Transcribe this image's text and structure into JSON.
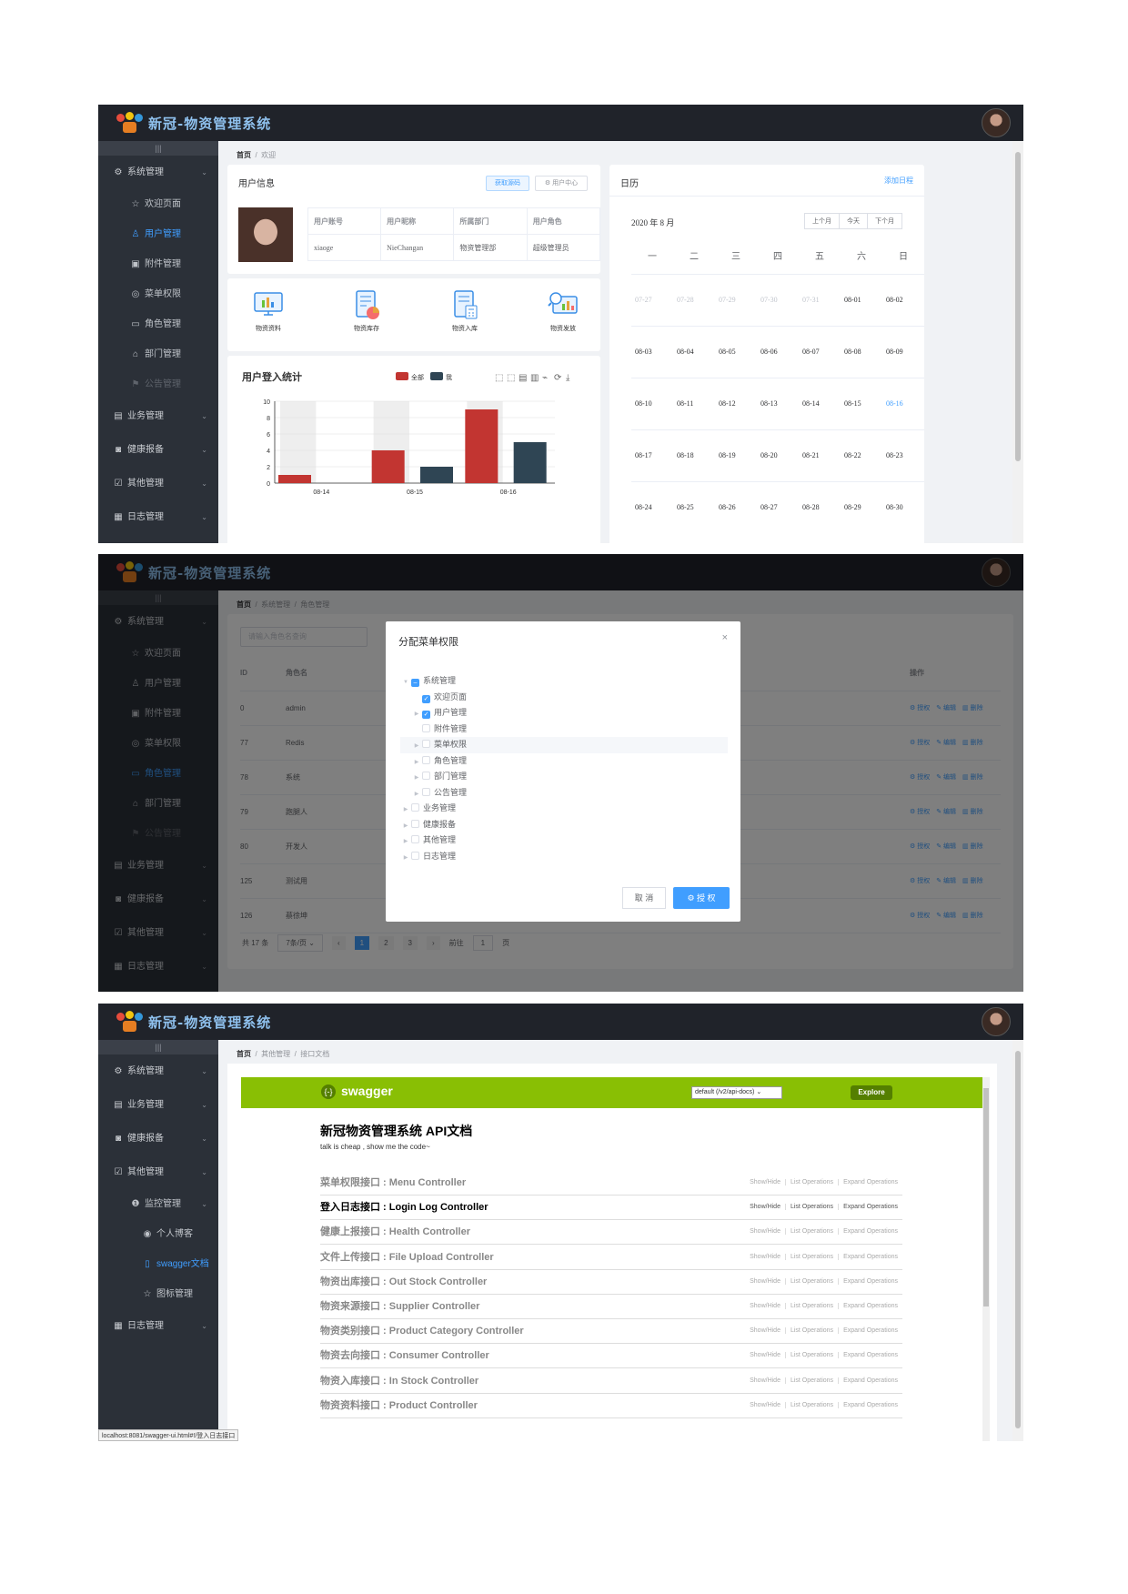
{
  "app": {
    "title": "新冠-物资管理系统"
  },
  "shot1": {
    "breadcrumb": [
      "首页",
      "欢迎"
    ],
    "sidebar": [
      {
        "label": "系统管理",
        "icon": "gear-icon",
        "level": 0
      },
      {
        "label": "欢迎页面",
        "icon": "star-icon",
        "level": 1
      },
      {
        "label": "用户管理",
        "icon": "user-icon",
        "level": 1,
        "active": true
      },
      {
        "label": "附件管理",
        "icon": "image-icon",
        "level": 1
      },
      {
        "label": "菜单权限",
        "icon": "menu-icon",
        "level": 1
      },
      {
        "label": "角色管理",
        "icon": "id-card-icon",
        "level": 1
      },
      {
        "label": "部门管理",
        "icon": "home-icon",
        "level": 1
      },
      {
        "label": "公告管理",
        "icon": "flag-icon",
        "level": 1,
        "disabled": true
      },
      {
        "label": "业务管理",
        "icon": "briefcase-icon",
        "level": 0
      },
      {
        "label": "健康报备",
        "icon": "report-icon",
        "level": 0
      },
      {
        "label": "其他管理",
        "icon": "check-square-icon",
        "level": 0
      },
      {
        "label": "日志管理",
        "icon": "calendar-icon",
        "level": 0
      }
    ],
    "user_card": {
      "title": "用户信息",
      "btn_source": "获取源码",
      "btn_center": "用户中心",
      "headers": [
        "用户账号",
        "用户昵称",
        "所属部门",
        "用户角色"
      ],
      "values": [
        "xiaoge",
        "NieChangan",
        "物资管理部",
        "超级管理员"
      ]
    },
    "quick": [
      "物资资料",
      "物资库存",
      "物资入库",
      "物资发放"
    ],
    "calendar": {
      "title": "日历",
      "add": "添加日程",
      "month": "2020 年 8 月",
      "buttons": [
        "上个月",
        "今天",
        "下个月"
      ],
      "weekdays": [
        "一",
        "二",
        "三",
        "四",
        "五",
        "六",
        "日"
      ],
      "weeks": [
        [
          "07-27",
          "07-28",
          "07-29",
          "07-30",
          "07-31",
          "08-01",
          "08-02"
        ],
        [
          "08-03",
          "08-04",
          "08-05",
          "08-06",
          "08-07",
          "08-08",
          "08-09"
        ],
        [
          "08-10",
          "08-11",
          "08-12",
          "08-13",
          "08-14",
          "08-15",
          "08-16"
        ],
        [
          "08-17",
          "08-18",
          "08-19",
          "08-20",
          "08-21",
          "08-22",
          "08-23"
        ],
        [
          "08-24",
          "08-25",
          "08-26",
          "08-27",
          "08-28",
          "08-29",
          "08-30"
        ]
      ],
      "today": "08-16"
    }
  },
  "chart_data": {
    "type": "bar",
    "title": "用户登入统计",
    "categories": [
      "08-14",
      "08-15",
      "08-16"
    ],
    "series": [
      {
        "name": "全部",
        "values": [
          1,
          4,
          9
        ],
        "color": "#c23531"
      },
      {
        "name": "我",
        "values": [
          0,
          2,
          5
        ],
        "color": "#2f4554"
      }
    ],
    "ylim": [
      0,
      10
    ],
    "yticks": [
      0,
      2,
      4,
      6,
      8,
      10
    ],
    "legend": "top"
  },
  "shot2": {
    "breadcrumb": [
      "首页",
      "系统管理",
      "角色管理"
    ],
    "search_placeholder": "请输入角色名查询",
    "sidebar": [
      {
        "label": "系统管理",
        "icon": "gear-icon",
        "level": 0
      },
      {
        "label": "欢迎页面",
        "icon": "star-icon",
        "level": 1
      },
      {
        "label": "用户管理",
        "icon": "user-icon",
        "level": 1
      },
      {
        "label": "附件管理",
        "icon": "image-icon",
        "level": 1
      },
      {
        "label": "菜单权限",
        "icon": "menu-icon",
        "level": 1
      },
      {
        "label": "角色管理",
        "icon": "id-card-icon",
        "level": 1,
        "active": true
      },
      {
        "label": "部门管理",
        "icon": "home-icon",
        "level": 1
      },
      {
        "label": "公告管理",
        "icon": "flag-icon",
        "level": 1,
        "disabled": true
      },
      {
        "label": "业务管理",
        "icon": "briefcase-icon",
        "level": 0
      },
      {
        "label": "健康报备",
        "icon": "report-icon",
        "level": 0
      },
      {
        "label": "其他管理",
        "icon": "check-square-icon",
        "level": 0
      },
      {
        "label": "日志管理",
        "icon": "calendar-icon",
        "level": 0
      }
    ],
    "table": {
      "headers": [
        "ID",
        "角色名",
        "操作"
      ],
      "rows": [
        [
          "0",
          "admin"
        ],
        [
          "77",
          "Redis"
        ],
        [
          "78",
          "系统"
        ],
        [
          "79",
          "跑腿人"
        ],
        [
          "80",
          "开发人"
        ],
        [
          "125",
          "测试用"
        ],
        [
          "126",
          "蔡徐坤"
        ]
      ],
      "ops": [
        "授权",
        "编辑",
        "删除"
      ]
    },
    "pagination": {
      "total": "共 17 条",
      "size": "7条/页",
      "pages": [
        "1",
        "2",
        "3"
      ],
      "goto": "前往",
      "page": "1",
      "unit": "页"
    },
    "dialog": {
      "title": "分配菜单权限",
      "tree": [
        {
          "label": "系统管理",
          "level": 0,
          "state": "half",
          "arrow": "open"
        },
        {
          "label": "欢迎页面",
          "level": 1,
          "state": "on",
          "arrow": "none"
        },
        {
          "label": "用户管理",
          "level": 1,
          "state": "on",
          "arrow": "closed"
        },
        {
          "label": "附件管理",
          "level": 1,
          "state": "off",
          "arrow": "none"
        },
        {
          "label": "菜单权限",
          "level": 1,
          "state": "off",
          "arrow": "closed",
          "hover": true
        },
        {
          "label": "角色管理",
          "level": 1,
          "state": "off",
          "arrow": "closed"
        },
        {
          "label": "部门管理",
          "level": 1,
          "state": "off",
          "arrow": "closed"
        },
        {
          "label": "公告管理",
          "level": 1,
          "state": "off",
          "arrow": "closed"
        },
        {
          "label": "业务管理",
          "level": 0,
          "state": "off",
          "arrow": "closed"
        },
        {
          "label": "健康报备",
          "level": 0,
          "state": "off",
          "arrow": "closed"
        },
        {
          "label": "其他管理",
          "level": 0,
          "state": "off",
          "arrow": "closed"
        },
        {
          "label": "日志管理",
          "level": 0,
          "state": "off",
          "arrow": "closed"
        }
      ],
      "cancel": "取 消",
      "confirm": "授 权"
    }
  },
  "shot3": {
    "breadcrumb": [
      "首页",
      "其他管理",
      "接口文档"
    ],
    "sidebar": [
      {
        "label": "系统管理",
        "icon": "gear-icon",
        "level": 0
      },
      {
        "label": "业务管理",
        "icon": "briefcase-icon",
        "level": 0
      },
      {
        "label": "健康报备",
        "icon": "report-icon",
        "level": 0
      },
      {
        "label": "其他管理",
        "icon": "check-square-icon",
        "level": 0
      },
      {
        "label": "监控管理",
        "icon": "alert-icon",
        "level": 1
      },
      {
        "label": "个人博客",
        "icon": "eye-icon",
        "level": 2
      },
      {
        "label": "swagger文档",
        "icon": "document-icon",
        "level": 2,
        "active": true
      },
      {
        "label": "图标管理",
        "icon": "star-icon",
        "level": 2
      },
      {
        "label": "日志管理",
        "icon": "calendar-icon",
        "level": 0
      }
    ],
    "swagger": {
      "brand": "swagger",
      "url": "default (/v2/api-docs)",
      "explore": "Explore",
      "title": "新冠物资管理系统 API文档",
      "subtitle": "talk is cheap , show me the code~",
      "apis": [
        "菜单权限接口 : Menu Controller",
        "登入日志接口 : Login Log Controller",
        "健康上报接口 : Health Controller",
        "文件上传接口 : File Upload Controller",
        "物资出库接口 : Out Stock Controller",
        "物资来源接口 : Supplier Controller",
        "物资类别接口 : Product Category Controller",
        "物资去向接口 : Consumer Controller",
        "物资入库接口 : In Stock Controller",
        "物资资料接口 : Product Controller"
      ],
      "actions": [
        "Show/Hide",
        "List Operations",
        "Expand Operations"
      ],
      "hot_index": 1
    },
    "statusbar": "localhost:8081/swagger-ui.html#!/登入日志接口"
  },
  "colors": {
    "accent": "#409eff",
    "sidebar": "#2b3038",
    "topbar": "#20232a",
    "swagger": "#89bf04"
  }
}
